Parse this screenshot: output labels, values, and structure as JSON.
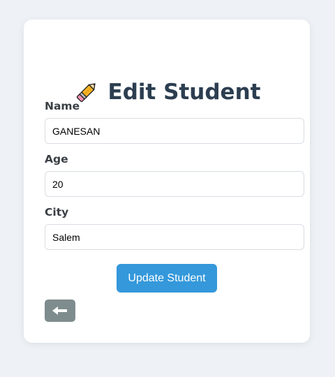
{
  "header": {
    "icon": "pencil-icon",
    "title": "Edit Student"
  },
  "form": {
    "name": {
      "label": "Name",
      "value": "GANESAN"
    },
    "age": {
      "label": "Age",
      "value": "20"
    },
    "city": {
      "label": "City",
      "value": "Salem"
    },
    "submit_label": "Update Student",
    "back_icon": "left-arrow-icon"
  },
  "colors": {
    "background": "#eef2f6",
    "title": "#2c3e50",
    "primary_button": "#3498db",
    "back_button": "#7f8c8d"
  }
}
